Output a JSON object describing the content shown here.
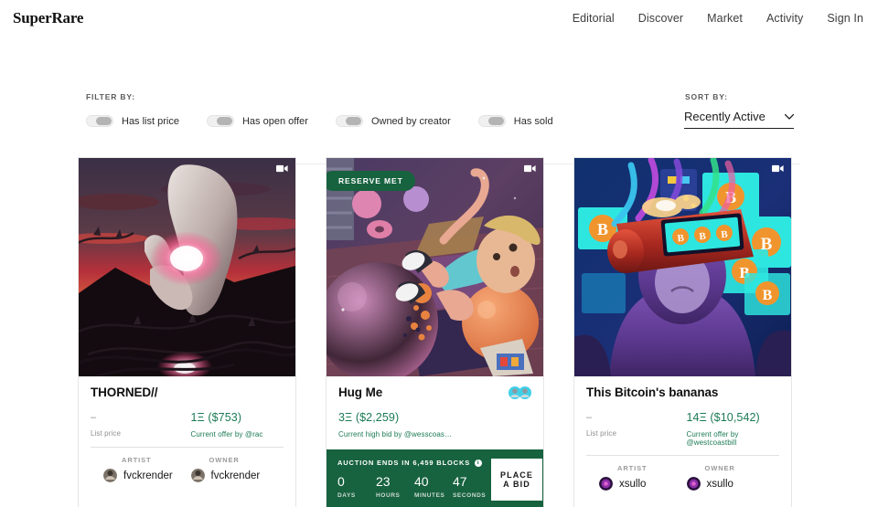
{
  "header": {
    "logo": "SuperRare",
    "nav": [
      {
        "label": "Editorial"
      },
      {
        "label": "Discover"
      },
      {
        "label": "Market"
      },
      {
        "label": "Activity"
      },
      {
        "label": "Sign In"
      }
    ]
  },
  "filters": {
    "label": "FILTER BY:",
    "toggles": [
      {
        "label": "Has list price",
        "state": "off"
      },
      {
        "label": "Has open offer",
        "state": "off"
      },
      {
        "label": "Owned by creator",
        "state": "off"
      },
      {
        "label": "Has sold",
        "state": "off"
      }
    ]
  },
  "sort": {
    "label": "SORT BY:",
    "value": "Recently Active",
    "icon": "chevron-down-icon"
  },
  "cards": [
    {
      "title": "THORNED//",
      "media_icon": "video-camera-icon",
      "badge": null,
      "list_price_value": "–",
      "list_price_label": "List price",
      "price_value": "1Ξ ($753)",
      "price_label": "Current offer by @rac",
      "artist_role": "ARTIST",
      "artist_name": "fvckrender",
      "owner_role": "OWNER",
      "owner_name": "fvckrender"
    },
    {
      "title": "Hug Me",
      "media_icon": "video-camera-icon",
      "badge": "RESERVE MET",
      "price_value": "3Ξ ($2,259)",
      "price_label": "Current high bid by @wesscoas…",
      "auction": {
        "headline": "AUCTION ENDS IN 6,459 BLOCKS",
        "info_icon": "info-icon",
        "units": [
          {
            "value": "0",
            "label": "DAYS"
          },
          {
            "value": "23",
            "label": "HOURS"
          },
          {
            "value": "40",
            "label": "MINUTES"
          },
          {
            "value": "47",
            "label": "SECONDS"
          }
        ],
        "bid_button": "PLACE A BID"
      }
    },
    {
      "title": "This Bitcoin's bananas",
      "media_icon": "video-camera-icon",
      "badge": null,
      "list_price_value": "–",
      "list_price_label": "List price",
      "price_value": "14Ξ ($10,542)",
      "price_label": "Current offer by @westcoastbill",
      "artist_role": "ARTIST",
      "artist_name": "xsullo",
      "owner_role": "OWNER",
      "owner_name": "xsullo"
    }
  ],
  "colors": {
    "accent_green": "#1b7a55",
    "auction_green": "#17623f",
    "text_dark": "#111111",
    "text_muted": "#8f8f8f"
  }
}
